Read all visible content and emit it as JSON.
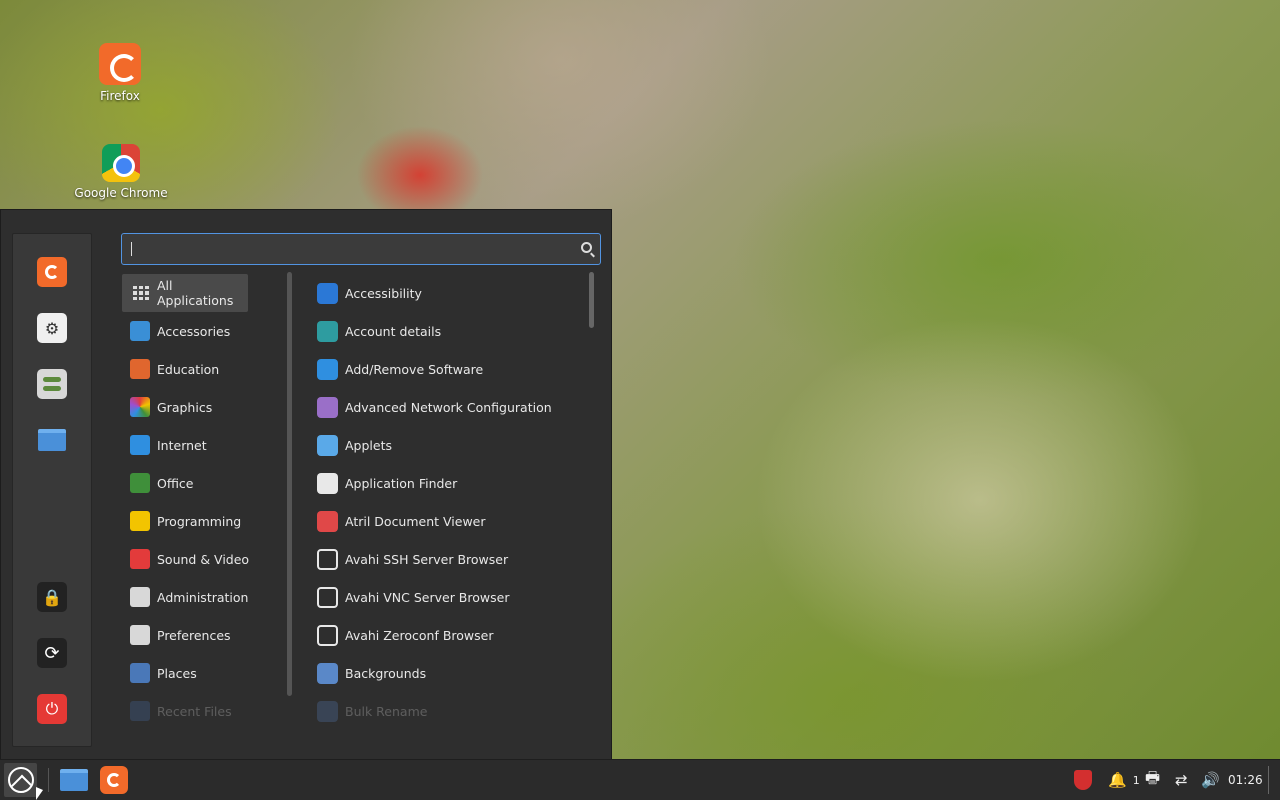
{
  "desktop": {
    "icons": [
      {
        "label": "Firefox",
        "icon": "firefox-icon"
      },
      {
        "label": "Google Chrome",
        "icon": "chrome-icon"
      }
    ]
  },
  "menu": {
    "search": {
      "value": "",
      "icon": "search-icon"
    },
    "favorites": [
      {
        "icon": "firefox-icon",
        "color": "#f26a2a"
      },
      {
        "icon": "settings-icon",
        "color": "#e8e8e8"
      },
      {
        "icon": "preferences-icon",
        "color": "#5c8a3c"
      },
      {
        "icon": "folder-icon",
        "color": "#4a90d9"
      }
    ],
    "session": [
      {
        "icon": "lock-icon",
        "color": "#2a2a2a"
      },
      {
        "icon": "logout-icon",
        "color": "#2a2a2a"
      },
      {
        "icon": "power-icon",
        "color": "#e53935"
      }
    ],
    "categories": [
      {
        "label": "All Applications",
        "icon": "grid-icon",
        "color": "#4a4a4a",
        "active": true
      },
      {
        "label": "Accessories",
        "icon": "accessories-icon",
        "color": "#3a8fd6"
      },
      {
        "label": "Education",
        "icon": "education-icon",
        "color": "#e0662e"
      },
      {
        "label": "Graphics",
        "icon": "graphics-icon",
        "color": "#9c4fd0"
      },
      {
        "label": "Internet",
        "icon": "internet-icon",
        "color": "#2f8fe0"
      },
      {
        "label": "Office",
        "icon": "office-icon",
        "color": "#3f8f3a"
      },
      {
        "label": "Programming",
        "icon": "programming-icon",
        "color": "#f2c400"
      },
      {
        "label": "Sound & Video",
        "icon": "sound-video-icon",
        "color": "#e33b3b"
      },
      {
        "label": "Administration",
        "icon": "administration-icon",
        "color": "#d8d8d8"
      },
      {
        "label": "Preferences",
        "icon": "preferences-icon",
        "color": "#d8d8d8"
      },
      {
        "label": "Places",
        "icon": "places-icon",
        "color": "#4a78b8"
      },
      {
        "label": "Recent Files",
        "icon": "recent-files-icon",
        "color": "#4a78b8",
        "faded": true
      }
    ],
    "apps": [
      {
        "label": "Accessibility",
        "icon": "accessibility-icon",
        "color": "#2b78d6"
      },
      {
        "label": "Account details",
        "icon": "account-icon",
        "color": "#2e9ca0"
      },
      {
        "label": "Add/Remove Software",
        "icon": "download-icon",
        "color": "#2f8fe0"
      },
      {
        "label": "Advanced Network Configuration",
        "icon": "network-icon",
        "color": "#9a6fc8"
      },
      {
        "label": "Applets",
        "icon": "applets-icon",
        "color": "#5aa9e8"
      },
      {
        "label": "Application Finder",
        "icon": "finder-icon",
        "color": "#e8e8e8"
      },
      {
        "label": "Atril Document Viewer",
        "icon": "atril-icon",
        "color": "#e04848"
      },
      {
        "label": "Avahi SSH Server Browser",
        "icon": "monitor-icon",
        "color": "#e8e8e8"
      },
      {
        "label": "Avahi VNC Server Browser",
        "icon": "monitor-icon",
        "color": "#e8e8e8"
      },
      {
        "label": "Avahi Zeroconf Browser",
        "icon": "monitor-icon",
        "color": "#e8e8e8"
      },
      {
        "label": "Backgrounds",
        "icon": "backgrounds-icon",
        "color": "#5a88c8"
      },
      {
        "label": "Bulk Rename",
        "icon": "rename-icon",
        "color": "#5a88c8",
        "faded": true
      }
    ]
  },
  "panel": {
    "launchers": [
      {
        "icon": "files-icon"
      },
      {
        "icon": "firefox-icon"
      }
    ],
    "tray": {
      "shield_icon": "shield-icon",
      "notifications_count": "1",
      "clock": "01:26"
    }
  }
}
